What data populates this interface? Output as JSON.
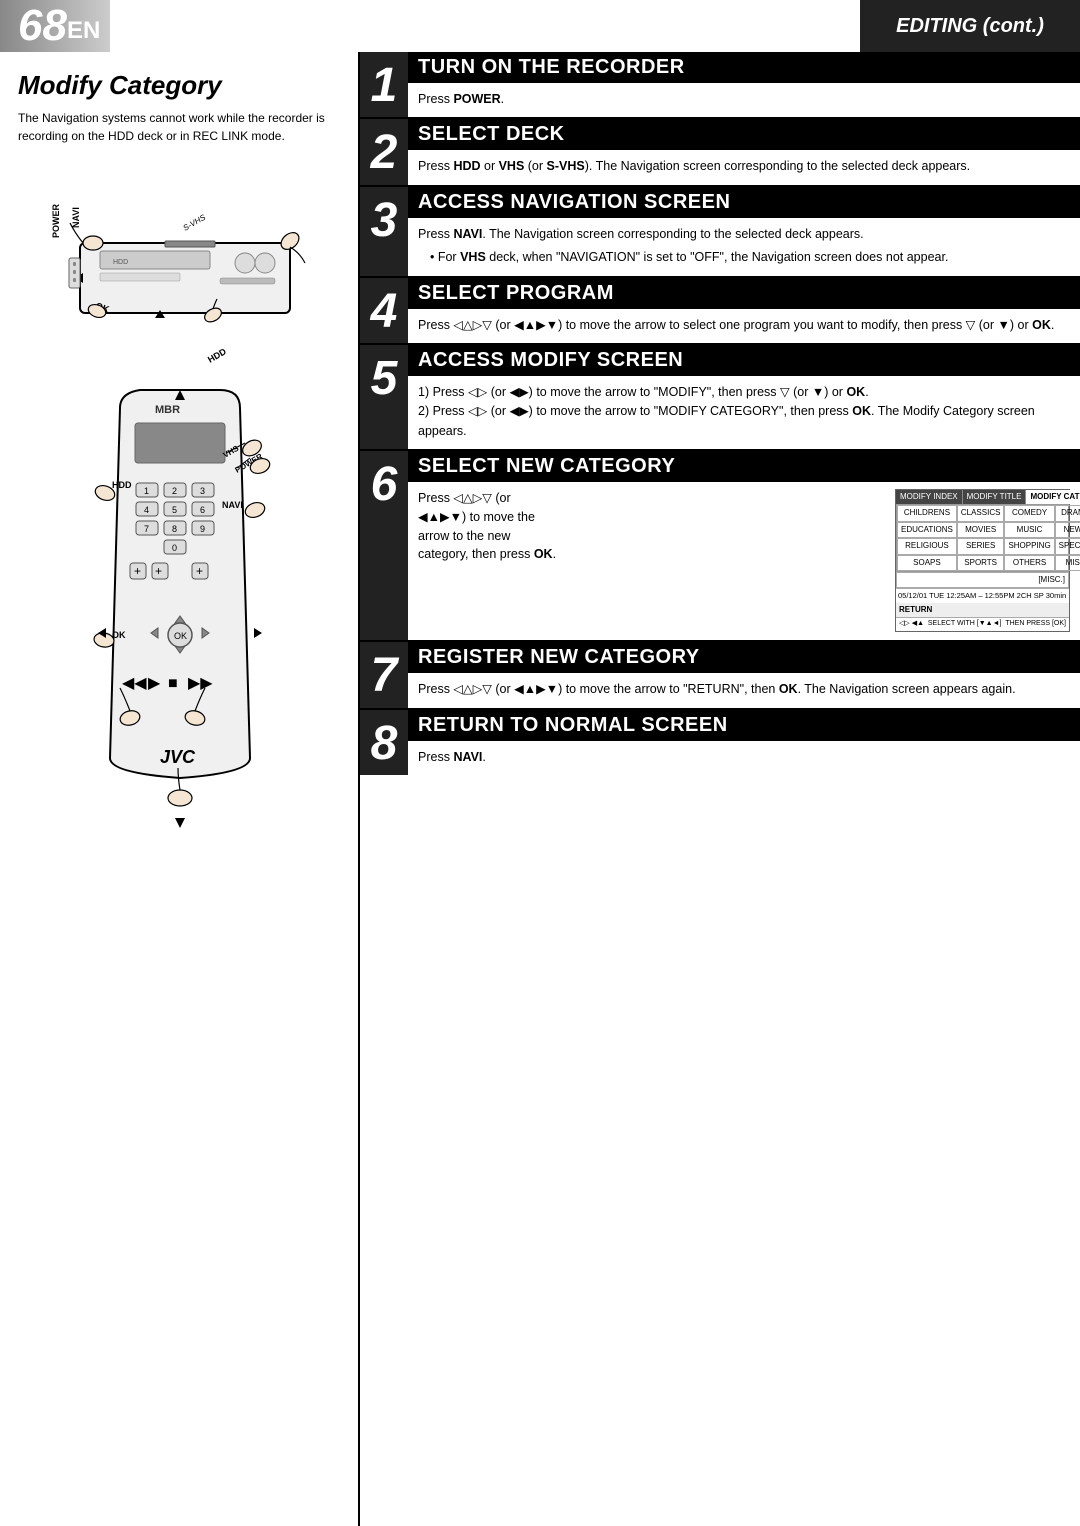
{
  "header": {
    "page_number": "68",
    "page_suffix": "EN",
    "section": "EDITING (cont.)"
  },
  "left": {
    "title": "Modify Category",
    "subtitle": "The Navigation systems cannot work while the recorder is recording on the HDD deck or in REC LINK mode."
  },
  "steps": [
    {
      "num": "1",
      "heading": "TURN ON THE RECORDER",
      "body": "Press <b>POWER</b>.",
      "bold_words": [
        "POWER"
      ]
    },
    {
      "num": "2",
      "heading": "SELECT DECK",
      "body": "Press <b>HDD</b> or <b>VHS</b> (or <b>S-VHS</b>). The Navigation screen corresponding to the selected deck appears.",
      "bold_words": [
        "HDD",
        "VHS",
        "S-VHS"
      ]
    },
    {
      "num": "3",
      "heading": "ACCESS NAVIGATION SCREEN",
      "body": "Press <b>NAVI</b>. The Navigation screen corresponding to the selected deck appears.",
      "bullet": "For <b>VHS</b> deck, when \"NAVIGATION\" is set to \"OFF\", the Navigation screen does not appear.",
      "bold_words": [
        "NAVI",
        "VHS"
      ]
    },
    {
      "num": "4",
      "heading": "SELECT PROGRAM",
      "body": "Press ◁△▷▽ (or ◀▲▶▼) to move the arrow to select one program you want to modify, then press ▽ (or ▼) or <b>OK</b>.",
      "bold_words": [
        "OK"
      ]
    },
    {
      "num": "5",
      "heading": "ACCESS MODIFY SCREEN",
      "body1": "1) Press ◁▷ (or ◀▶) to move the arrow to \"MODIFY\", then press ▽ (or ▼) or <b>OK</b>.",
      "body2": "2) Press ◁▷ (or ◀▶) to move the arrow to \"MODIFY CATEGORY\", then press <b>OK</b>. The Modify Category screen appears.",
      "bold_words": [
        "OK"
      ]
    },
    {
      "num": "6",
      "heading": "SELECT NEW CATEGORY",
      "body": "Press ◁△▷▽ (or ◀▲▶▼) to move the arrow to the new category, then press <b>OK</b>.",
      "bold_words": [
        "OK"
      ],
      "screen": {
        "tabs": [
          "MODIFY INDEX",
          "MODIFY TITLE",
          "MODIFY CATEGORY"
        ],
        "active_tab": "MODIFY CATEGORY",
        "rows": [
          [
            "CHILDRENS",
            "CLASSICS",
            "COMEDY",
            "DRAMA"
          ],
          [
            "EDUCATIONS",
            "MOVIES",
            "MUSIC",
            "NEWS"
          ],
          [
            "RELIGIOUS",
            "SERIES",
            "SHOPPING",
            "SPECIAL"
          ],
          [
            "SOAPS",
            "SPORTS",
            "OTHERS",
            "MISC"
          ]
        ],
        "misc_row": "[MISC.]",
        "footer": "05/12/01 TUE 12:25AM – 12:55PM  2CH  SP  30min",
        "return": "RETURN",
        "icons_left": "◁▷ ◀▲▶",
        "icons_mid": "SELECT WITH [▼▲◄]",
        "icons_right": "THEN PRESS [OK]"
      }
    },
    {
      "num": "7",
      "heading": "REGISTER NEW CATEGORY",
      "body": "Press ◁△▷▽ (or ◀▲▶▼) to move the arrow to \"RETURN\", then <b>OK</b>. The Navigation screen appears again.",
      "bold_words": [
        "OK"
      ]
    },
    {
      "num": "8",
      "heading": "RETURN TO NORMAL SCREEN",
      "body": "Press <b>NAVI</b>.",
      "bold_words": [
        "NAVI"
      ]
    }
  ]
}
